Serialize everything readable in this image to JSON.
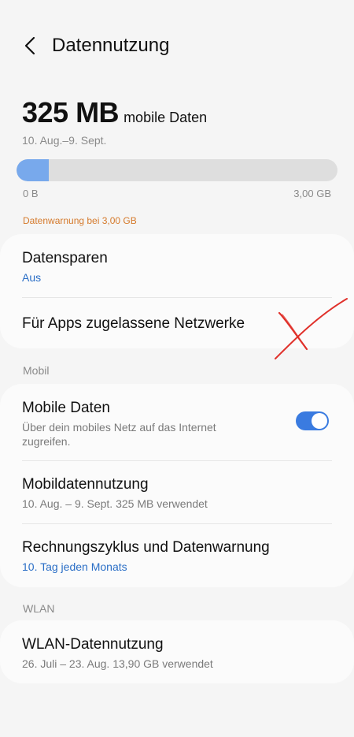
{
  "header": {
    "title": "Datennutzung"
  },
  "usage": {
    "amount": "325 MB",
    "unit": "mobile Daten",
    "period": "10. Aug.–9. Sept.",
    "bar_fraction": 0.1,
    "min_label": "0 B",
    "max_label": "3,00 GB",
    "warning": "Datenwarnung bei 3,00 GB"
  },
  "card1": {
    "datensparen_title": "Datensparen",
    "datensparen_value": "Aus",
    "apps_networks_title": "Für Apps zugelassene Netzwerke"
  },
  "mobil": {
    "section_label": "Mobil",
    "mobile_data_title": "Mobile Daten",
    "mobile_data_sub": "Über dein mobiles Netz auf das Internet zugreifen.",
    "mobile_data_enabled": true,
    "usage_title": "Mobildatennutzung",
    "usage_sub": "10. Aug. – 9. Sept. 325 MB verwendet",
    "billing_title": "Rechnungszyklus und Datenwarnung",
    "billing_sub": "10. Tag jeden Monats"
  },
  "wlan": {
    "section_label": "WLAN",
    "usage_title": "WLAN-Datennutzung",
    "usage_sub": "26. Juli – 23. Aug. 13,90 GB verwendet"
  },
  "colors": {
    "accent_blue": "#3a7be0",
    "link_blue": "#2a6ec6",
    "warning_orange": "#d57a2c",
    "bar_fill": "#78a9ec",
    "annotation_red": "#e0302a"
  }
}
